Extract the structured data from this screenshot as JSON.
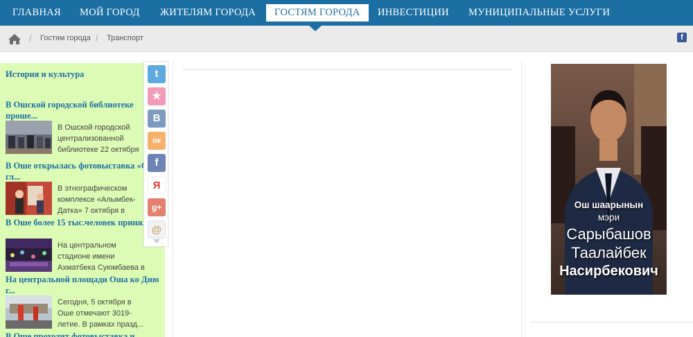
{
  "nav": {
    "items": [
      {
        "label": "ГЛАВНАЯ"
      },
      {
        "label": "МОЙ ГОРОД"
      },
      {
        "label": "ЖИТЕЛЯМ ГОРОДА"
      },
      {
        "label": "ГОСТЯМ ГОРОДА",
        "active": true
      },
      {
        "label": "ИНВЕСТИЦИИ"
      },
      {
        "label": "МУНИЦИПАЛЬНЫЕ УСЛУГИ"
      }
    ]
  },
  "breadcrumb": {
    "items": [
      "Гостям города",
      "Транспорт"
    ],
    "sep": "/"
  },
  "facebook_icon": "f",
  "sidebar": {
    "section_title": "История и культура",
    "news": [
      {
        "title": "В Ошской городской библиотеке проше...",
        "text": "В Ошской городской централизованной библиотеке 22 октября пр..."
      },
      {
        "title": "В Оше открылась фотовыставка «Ош гл...",
        "text": "В этнографическом комплексе «Алымбек-Датка» 7 октября в рамках..."
      },
      {
        "title": "В Оше более 15 тыс.человек приняли ...",
        "text": "На центральном стадионе имени Ахматбека Суюмбаева в Оше 5 ок..."
      },
      {
        "title": "На центральной площади Оша ко Дню г...",
        "text": "Сегодня, 5 октября в Оше отмечают 3019-летие. В рамках празд..."
      },
      {
        "title": "В Оше проходит фотовыставка и",
        "text": ""
      }
    ]
  },
  "share": {
    "buttons": [
      {
        "name": "twitter-icon",
        "glyph": "t",
        "color": "#5ea9dd"
      },
      {
        "name": "favorites-icon",
        "glyph": "★",
        "color": "#f29ab8"
      },
      {
        "name": "vkontakte-icon",
        "glyph": "B",
        "color": "#7d9bc0"
      },
      {
        "name": "odnoklassniki-icon",
        "glyph": "ок",
        "color": "#f6b26b"
      },
      {
        "name": "facebook-icon",
        "glyph": "f",
        "color": "#6d84b4"
      },
      {
        "name": "yandex-icon",
        "glyph": "Я",
        "color": "#ffffff"
      },
      {
        "name": "google-plus-icon",
        "glyph": "g+",
        "color": "#e3806f"
      },
      {
        "name": "moimir-icon",
        "glyph": "@",
        "color": "#c8a070"
      }
    ]
  },
  "mayor_banner": {
    "line1": "Ош шаарынын",
    "line2": "мэри",
    "line3": "Сарыбашов",
    "line4": "Таалайбек",
    "line5": "Насирбекович"
  }
}
